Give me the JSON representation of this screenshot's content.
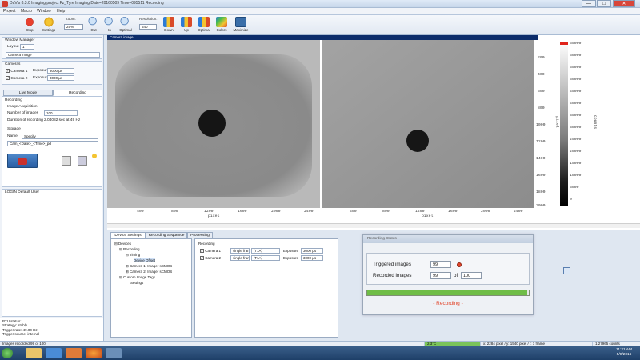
{
  "window": {
    "title": "DaVis 8.3.0 Imaging project Fz_Tyre Imaging Date=20160509 Time=095511 Recording",
    "minimize": "—",
    "maximize": "□",
    "close": "✕"
  },
  "menu": [
    "Project",
    "Macro",
    "Window",
    "Help"
  ],
  "toolbar": {
    "stop_label": "Stop",
    "settings_label": "Settings",
    "zoom_label": "Zoom:",
    "zoom_value": "25%",
    "out_label": "Out",
    "in_label": "In",
    "optimal_label": "Optimal",
    "resolution_label": "Resolution:",
    "resolution_value": "640",
    "down_label": "Down",
    "up_label": "Up",
    "optimal2_label": "Optimal",
    "colors_label": "Colors",
    "maximize_label": "Maximize"
  },
  "left": {
    "window_manager_title": "Window Manager",
    "layout_label": "Layout",
    "layout_value": "1",
    "view_select": "Camera image",
    "camera_title": "Cameras",
    "cameras": [
      {
        "label": "Camera 1",
        "exposure_label": "Exposure",
        "exposure": "3000 µs",
        "checked": true
      },
      {
        "label": "Camera 2",
        "exposure_label": "Exposure",
        "exposure": "3000 µs",
        "checked": true
      }
    ],
    "tab_live": "Live Mode",
    "tab_recording": "Recording",
    "recording_title": "Recording",
    "acq_title": "Image Acquisition",
    "num_images_label": "Number of images",
    "num_images": "100",
    "duration_label": "Duration of recording",
    "duration": "2.04082 sec at 49 Hz",
    "storage_title": "Storage",
    "name_label": "Name",
    "name_value": "Specify",
    "path_value": "Cam_<Date>_<Time>_pd",
    "user_text": "LOGIN Default User",
    "status_lines": [
      "PTU status:",
      "Strategy: stably",
      "Trigger rate: 49.00 Hz",
      "Trigger source: internal"
    ]
  },
  "canvas": {
    "title": "Camera image",
    "x_ticks_1": [
      "400",
      "800",
      "1200",
      "1600",
      "2000",
      "2400"
    ],
    "x_ticks_2": [
      "400",
      "800",
      "1200",
      "1600",
      "2000",
      "2400"
    ],
    "x_axis_label": "pixel",
    "y_ticks": [
      "200",
      "400",
      "600",
      "800",
      "1000",
      "1200",
      "1400",
      "1600",
      "1800",
      "2000"
    ],
    "y_axis_label": "pixel",
    "colorbar_ticks": [
      "65000",
      "60000",
      "55000",
      "50000",
      "45000",
      "40000",
      "35000",
      "30000",
      "25000",
      "20000",
      "15000",
      "10000",
      "5000",
      "0"
    ],
    "colorbar_label": "counts"
  },
  "bottom": {
    "tabs": [
      "Device Settings",
      "Recording Sequence",
      "Processing"
    ],
    "tree": [
      {
        "label": "Devices",
        "indent": 0
      },
      {
        "label": "Recording",
        "indent": 1
      },
      {
        "label": "Timing",
        "indent": 2
      },
      {
        "label": "Device Offset",
        "indent": 3
      },
      {
        "label": "Camera 1: Imager sCMOS",
        "indent": 2
      },
      {
        "label": "Camera 2: Imager sCMOS",
        "indent": 2
      },
      {
        "label": "Custom Image Tags",
        "indent": 1
      },
      {
        "label": "Settings",
        "indent": 2
      }
    ],
    "rec_title": "Recording",
    "rec_rows": [
      {
        "camera": "Camera 1",
        "mode": "single frame",
        "code": "[T1A]",
        "exposure_label": "Exposure",
        "exposure": "3000 µs"
      },
      {
        "camera": "Camera 2",
        "mode": "single frame",
        "code": "[T1A]",
        "exposure_label": "Exposure",
        "exposure": "3000 µs"
      }
    ]
  },
  "status_dialog": {
    "title": "Recording Status",
    "triggered_label": "Triggered images",
    "triggered_value": "99",
    "recorded_label": "Recorded images",
    "recorded_value": "99",
    "of_label": "of",
    "total_value": "100",
    "progress": 0.99,
    "status_text": "- Recording -"
  },
  "statusbar": {
    "left": "Images recorded 99 of 100",
    "temp": "2.3°C",
    "coords": "x: 2284 pixel / y: 1540 pixel / f: 1 frame",
    "counts": "1.27965 counts"
  },
  "taskbar": {
    "time": "11:21 AM",
    "date": "5/9/2016"
  },
  "colors": {
    "accent": "#0b2c6b",
    "record_red": "#e2452a",
    "progress_green": "#5aa336"
  }
}
